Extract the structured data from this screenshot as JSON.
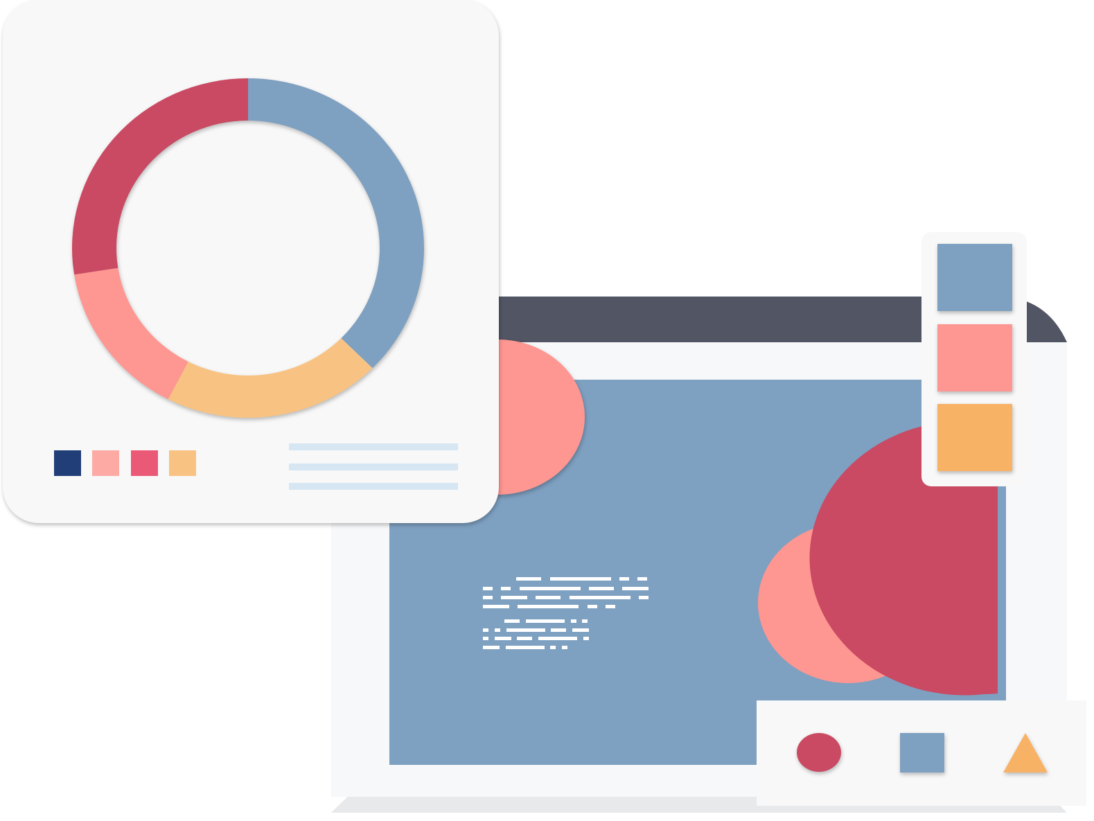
{
  "colors": {
    "background": "#ffffff",
    "card": "#f8f8f8",
    "monitor_frame": "#f7f8f9",
    "monitor_titlebar": "#525563",
    "monitor_stand": "#e8e9eb",
    "screen": "#7ea0c1",
    "blue": "#7ea0c1",
    "crimson": "#c94a62",
    "salmon": "#fe9691",
    "orange": "#f8b266",
    "peach": "#f8c382",
    "navy": "#223e78",
    "pink": "#fdaaa4",
    "red": "#ea5a76",
    "text_line": "#d6e6f3",
    "screen_text": "#ffffff"
  },
  "donut_card": {
    "chart_data": {
      "type": "pie",
      "shape": "donut",
      "values": [
        37.5,
        20,
        15,
        27.5
      ],
      "slice_colors": [
        "#7ea0c1",
        "#f8c382",
        "#fe9691",
        "#c94a62"
      ],
      "title": "",
      "labels_shown": false
    },
    "legend": {
      "swatch_colors": [
        "#223e78",
        "#fdaaa4",
        "#ea5a76",
        "#f8c382"
      ]
    },
    "placeholder_lines": 3
  },
  "monitor": {
    "screen_text_blocks": 2
  },
  "color_palette": {
    "swatches": [
      "#7ea0c1",
      "#fe9691",
      "#f8b266"
    ]
  },
  "shape_toolbar": {
    "tools": [
      {
        "icon": "circle-icon",
        "color": "#c94a62"
      },
      {
        "icon": "square-icon",
        "color": "#7ea0c1"
      },
      {
        "icon": "triangle-icon",
        "color": "#f8b266"
      }
    ]
  }
}
